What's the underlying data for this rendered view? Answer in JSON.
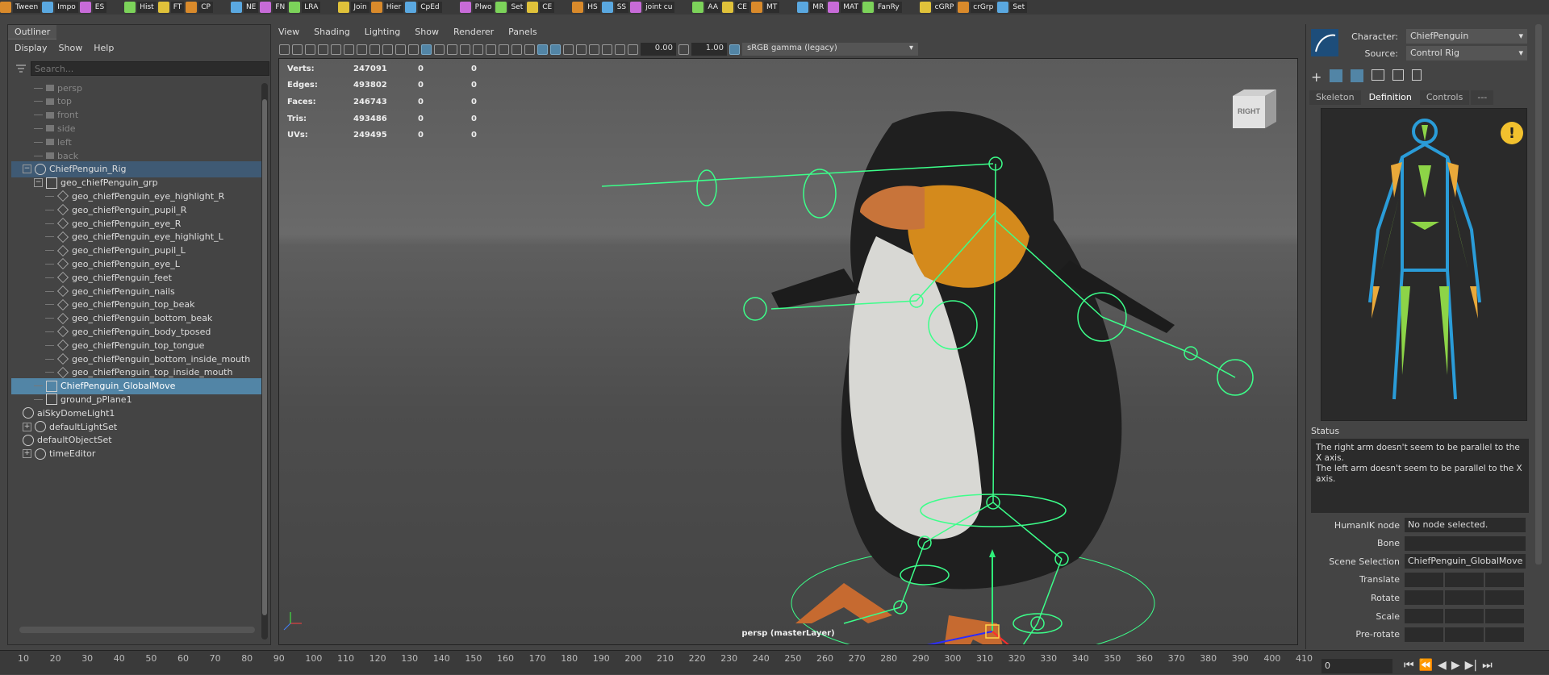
{
  "shelf": {
    "buttons": [
      "Tween",
      "Impo",
      "ES",
      "Hist",
      "FT",
      "CP",
      "NE",
      "FN",
      "LRA",
      "Join",
      "Hier",
      "CpEd",
      "Plwo",
      "Set",
      "CE",
      "HS",
      "SS",
      "joint cu",
      "AA",
      "CE",
      "MT",
      "MR",
      "MAT",
      "FanRy",
      "cGRP",
      "crGrp",
      "Set"
    ]
  },
  "outliner": {
    "tab": "Outliner",
    "menu": [
      "Display",
      "Show",
      "Help"
    ],
    "search_placeholder": "Search...",
    "items": [
      {
        "label": "persp",
        "indent": 1,
        "dim": true
      },
      {
        "label": "top",
        "indent": 1,
        "dim": true
      },
      {
        "label": "front",
        "indent": 1,
        "dim": true
      },
      {
        "label": "side",
        "indent": 1,
        "dim": true
      },
      {
        "label": "left",
        "indent": 1,
        "dim": true
      },
      {
        "label": "back",
        "indent": 1,
        "dim": true
      },
      {
        "label": "ChiefPenguin_Rig",
        "indent": 0,
        "expander": "−",
        "selected": "soft"
      },
      {
        "label": "geo_chiefPenguin_grp",
        "indent": 1,
        "expander": "−"
      },
      {
        "label": "geo_chiefPenguin_eye_highlight_R",
        "indent": 2
      },
      {
        "label": "geo_chiefPenguin_pupil_R",
        "indent": 2
      },
      {
        "label": "geo_chiefPenguin_eye_R",
        "indent": 2
      },
      {
        "label": "geo_chiefPenguin_eye_highlight_L",
        "indent": 2
      },
      {
        "label": "geo_chiefPenguin_pupil_L",
        "indent": 2
      },
      {
        "label": "geo_chiefPenguin_eye_L",
        "indent": 2
      },
      {
        "label": "geo_chiefPenguin_feet",
        "indent": 2
      },
      {
        "label": "geo_chiefPenguin_nails",
        "indent": 2
      },
      {
        "label": "geo_chiefPenguin_top_beak",
        "indent": 2
      },
      {
        "label": "geo_chiefPenguin_bottom_beak",
        "indent": 2
      },
      {
        "label": "geo_chiefPenguin_body_tposed",
        "indent": 2
      },
      {
        "label": "geo_chiefPenguin_top_tongue",
        "indent": 2
      },
      {
        "label": "geo_chiefPenguin_bottom_inside_mouth",
        "indent": 2
      },
      {
        "label": "geo_chiefPenguin_top_inside_mouth",
        "indent": 2
      },
      {
        "label": "ChiefPenguin_GlobalMove",
        "indent": 1,
        "selected": "hard"
      },
      {
        "label": "ground_pPlane1",
        "indent": 1
      },
      {
        "label": "aiSkyDomeLight1",
        "indent": 0
      },
      {
        "label": "defaultLightSet",
        "indent": 0,
        "expander": "+"
      },
      {
        "label": "defaultObjectSet",
        "indent": 0
      },
      {
        "label": "timeEditor",
        "indent": 0,
        "expander": "+"
      }
    ]
  },
  "viewport": {
    "menu": [
      "View",
      "Shading",
      "Lighting",
      "Show",
      "Renderer",
      "Panels"
    ],
    "exposure": "0.00",
    "gamma": "1.00",
    "colorspace": "sRGB gamma (legacy)",
    "hud": [
      {
        "label": "Verts:",
        "v1": "247091",
        "v2": "0",
        "v3": "0"
      },
      {
        "label": "Edges:",
        "v1": "493802",
        "v2": "0",
        "v3": "0"
      },
      {
        "label": "Faces:",
        "v1": "246743",
        "v2": "0",
        "v3": "0"
      },
      {
        "label": "Tris:",
        "v1": "493486",
        "v2": "0",
        "v3": "0"
      },
      {
        "label": "UVs:",
        "v1": "249495",
        "v2": "0",
        "v3": "0"
      }
    ],
    "camera_label": "persp (masterLayer)",
    "viewcube_label": "RIGHT"
  },
  "hik": {
    "character_label": "Character:",
    "character_value": "ChiefPenguin",
    "source_label": "Source:",
    "source_value": "Control Rig",
    "tabs": [
      "Skeleton",
      "Definition",
      "Controls",
      "---"
    ],
    "active_tab": "Definition",
    "status_header": "Status",
    "status_lines": [
      "The right arm doesn't seem to be parallel to the X axis.",
      "The left arm doesn't seem to be parallel to the X axis."
    ],
    "props": [
      {
        "label": "HumanIK node",
        "value": "No node selected."
      },
      {
        "label": "Bone",
        "value": ""
      },
      {
        "label": "Scene Selection",
        "value": "ChiefPenguin_GlobalMove"
      },
      {
        "label": "Translate",
        "value": null
      },
      {
        "label": "Rotate",
        "value": null
      },
      {
        "label": "Scale",
        "value": null
      },
      {
        "label": "Pre-rotate",
        "value": null
      }
    ]
  },
  "timeline": {
    "ticks": [
      "10",
      "20",
      "30",
      "40",
      "50",
      "60",
      "70",
      "80",
      "90",
      "100",
      "110",
      "120",
      "130",
      "140",
      "150",
      "160",
      "170",
      "180",
      "190",
      "200",
      "210",
      "220",
      "230",
      "240",
      "250",
      "260",
      "270",
      "280",
      "290",
      "300",
      "310",
      "320",
      "330",
      "340",
      "350",
      "360",
      "370",
      "380",
      "390",
      "400",
      "410"
    ],
    "current_frame": "0"
  },
  "colors": {
    "selection": "#5285a6",
    "rig_green": "#3cff8a",
    "panel_bg": "#444444"
  }
}
